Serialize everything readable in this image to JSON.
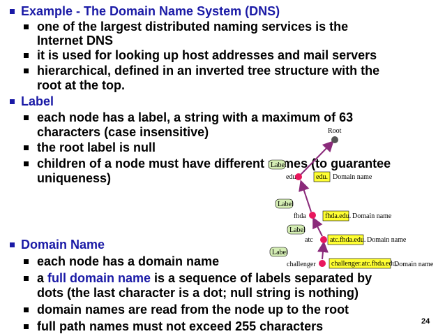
{
  "slide": {
    "page_number": "24",
    "bullets": {
      "example_title": "Example - The Domain Name System (DNS)",
      "example_1_line1": "one of the largest distributed naming services is the",
      "example_1_line2": "Internet DNS",
      "example_2": "it is used for looking up host addresses and mail servers",
      "example_3_line1": "hierarchical, defined in an inverted tree structure with the",
      "example_3_line2": "root at the top.",
      "label_title": "Label",
      "label_1_line1": "each node has a label, a string with a maximum of 63",
      "label_1_line2": "characters (case insensitive)",
      "label_2": "the root label is null",
      "label_3_line1": "children of a node must have different names (to guarantee",
      "label_3_line2": "uniqueness)",
      "domain_title": "Domain Name",
      "domain_1": "each node has a domain name",
      "domain_2_prefix": "a ",
      "domain_2_highlight": "full domain name",
      "domain_2_suffix": " is a sequence of labels separated by",
      "domain_2_line2": "dots (the last character is a dot; null string is nothing)",
      "domain_3": "domain names are read from the node up to the root",
      "domain_4": "full path names must not exceed 255 characters"
    }
  },
  "diagram": {
    "root_label": "Root",
    "label_tag": "Label",
    "domain_name_caption": "Domain name",
    "nodes": [
      {
        "name": "edu",
        "domain": "edu."
      },
      {
        "name": "fhda",
        "domain": "fhda.edu."
      },
      {
        "name": "atc",
        "domain": "atc.fhda.edu."
      },
      {
        "name": "challenger",
        "domain": "challenger.atc.fhda.edu."
      }
    ],
    "colors": {
      "node_fill": "#e8175d",
      "root_fill": "#555555",
      "edge": "#8a2a7a",
      "label_bubble": "#d4edb4",
      "domain_box": "#ffff33"
    }
  }
}
